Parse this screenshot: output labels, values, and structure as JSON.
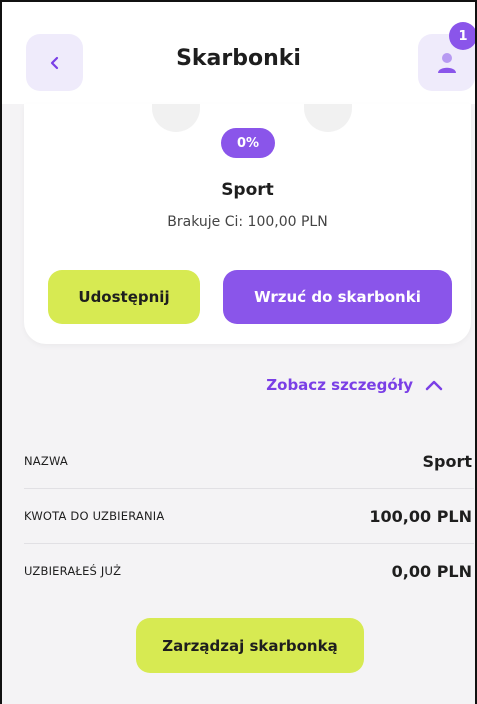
{
  "header": {
    "title": "Skarbonki",
    "notification_count": "1",
    "back_icon": "chevron-left-icon",
    "profile_icon": "user-icon"
  },
  "card": {
    "progress_label": "0%",
    "goal_name": "Sport",
    "missing_text": "Brakuje Ci: 100,00 PLN",
    "share_label": "Udostępnij",
    "deposit_label": "Wrzuć do skarbonki"
  },
  "details": {
    "toggle_label": "Zobacz szczegóły",
    "toggle_icon": "chevron-up-icon",
    "rows": [
      {
        "label": "NAZWA",
        "value": "Sport"
      },
      {
        "label": "KWOTA DO UZBIERANIA",
        "value": "100,00 PLN"
      },
      {
        "label": "UZBIERAŁEŚ JUŻ",
        "value": "0,00 PLN"
      }
    ]
  },
  "manage_label": "Zarządzaj skarbonką",
  "colors": {
    "accent": "#8a55ea",
    "lime": "#d7ea52",
    "background": "#f4f3f5"
  }
}
